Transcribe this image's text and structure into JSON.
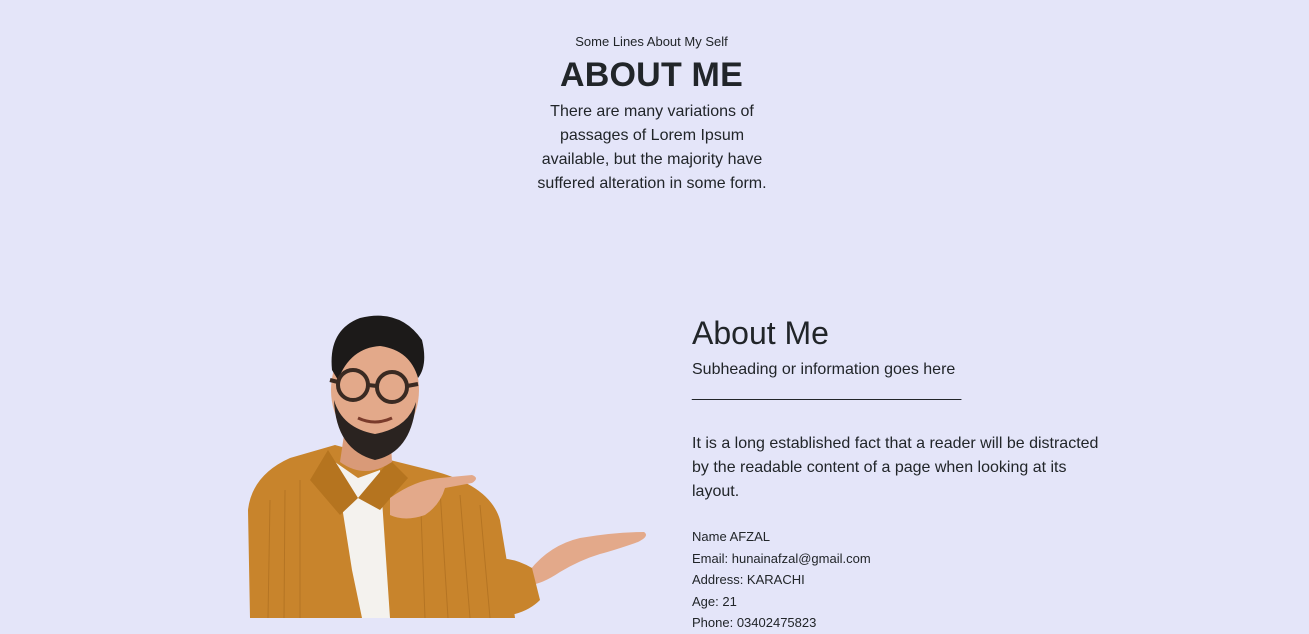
{
  "header": {
    "eyebrow": "Some Lines About My Self",
    "title": "ABOUT ME",
    "intro": "There are many variations of passages of Lorem Ipsum available, but the majority have suffered alteration in some form."
  },
  "about": {
    "heading": "About Me",
    "subheading": "Subheading or information goes here",
    "rule": "________________________________",
    "body": "It is a long established fact that a reader will be distracted by the readable content of a page when looking at its layout.",
    "details": {
      "name": "Name AFZAL",
      "email": "Email: hunainafzal@gmail.com",
      "address": "Address: KARACHI",
      "age": "Age: 21",
      "phone": "Phone: 03402475823"
    }
  },
  "colors": {
    "background": "#e4e5f9",
    "text": "#212529",
    "jacket": "#c8842c",
    "skin": "#e3a98a"
  },
  "images": {
    "portrait": "man-pointing-portrait"
  }
}
